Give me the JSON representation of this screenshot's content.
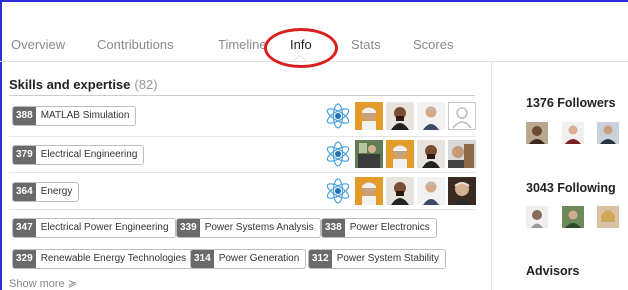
{
  "tabs": [
    {
      "label": "Overview"
    },
    {
      "label": "Contributions"
    },
    {
      "label": "Timeline"
    },
    {
      "label": "Info"
    },
    {
      "label": "Stats"
    },
    {
      "label": "Scores"
    }
  ],
  "active_tab": "Info",
  "skills": {
    "title": "Skills and expertise",
    "count": "(82)",
    "featured": [
      {
        "count": "388",
        "label": "MATLAB Simulation"
      },
      {
        "count": "379",
        "label": "Electrical Engineering"
      },
      {
        "count": "364",
        "label": "Energy"
      }
    ],
    "tags": [
      {
        "count": "347",
        "label": "Electrical Power Engineering"
      },
      {
        "count": "339",
        "label": "Power Systems Analysis"
      },
      {
        "count": "338",
        "label": "Power Electronics"
      },
      {
        "count": "329",
        "label": "Renewable Energy Technologies"
      },
      {
        "count": "314",
        "label": "Power Generation"
      },
      {
        "count": "312",
        "label": "Power System Stability"
      }
    ],
    "show_more": "Show more ≽"
  },
  "sidebar": {
    "followers": "1376 Followers",
    "following": "3043 Following",
    "advisors": "Advisors"
  },
  "colors": {
    "accent": "#d81f1f",
    "frame": "#2b2bd9",
    "tag_count_bg": "#6a6a6a"
  }
}
